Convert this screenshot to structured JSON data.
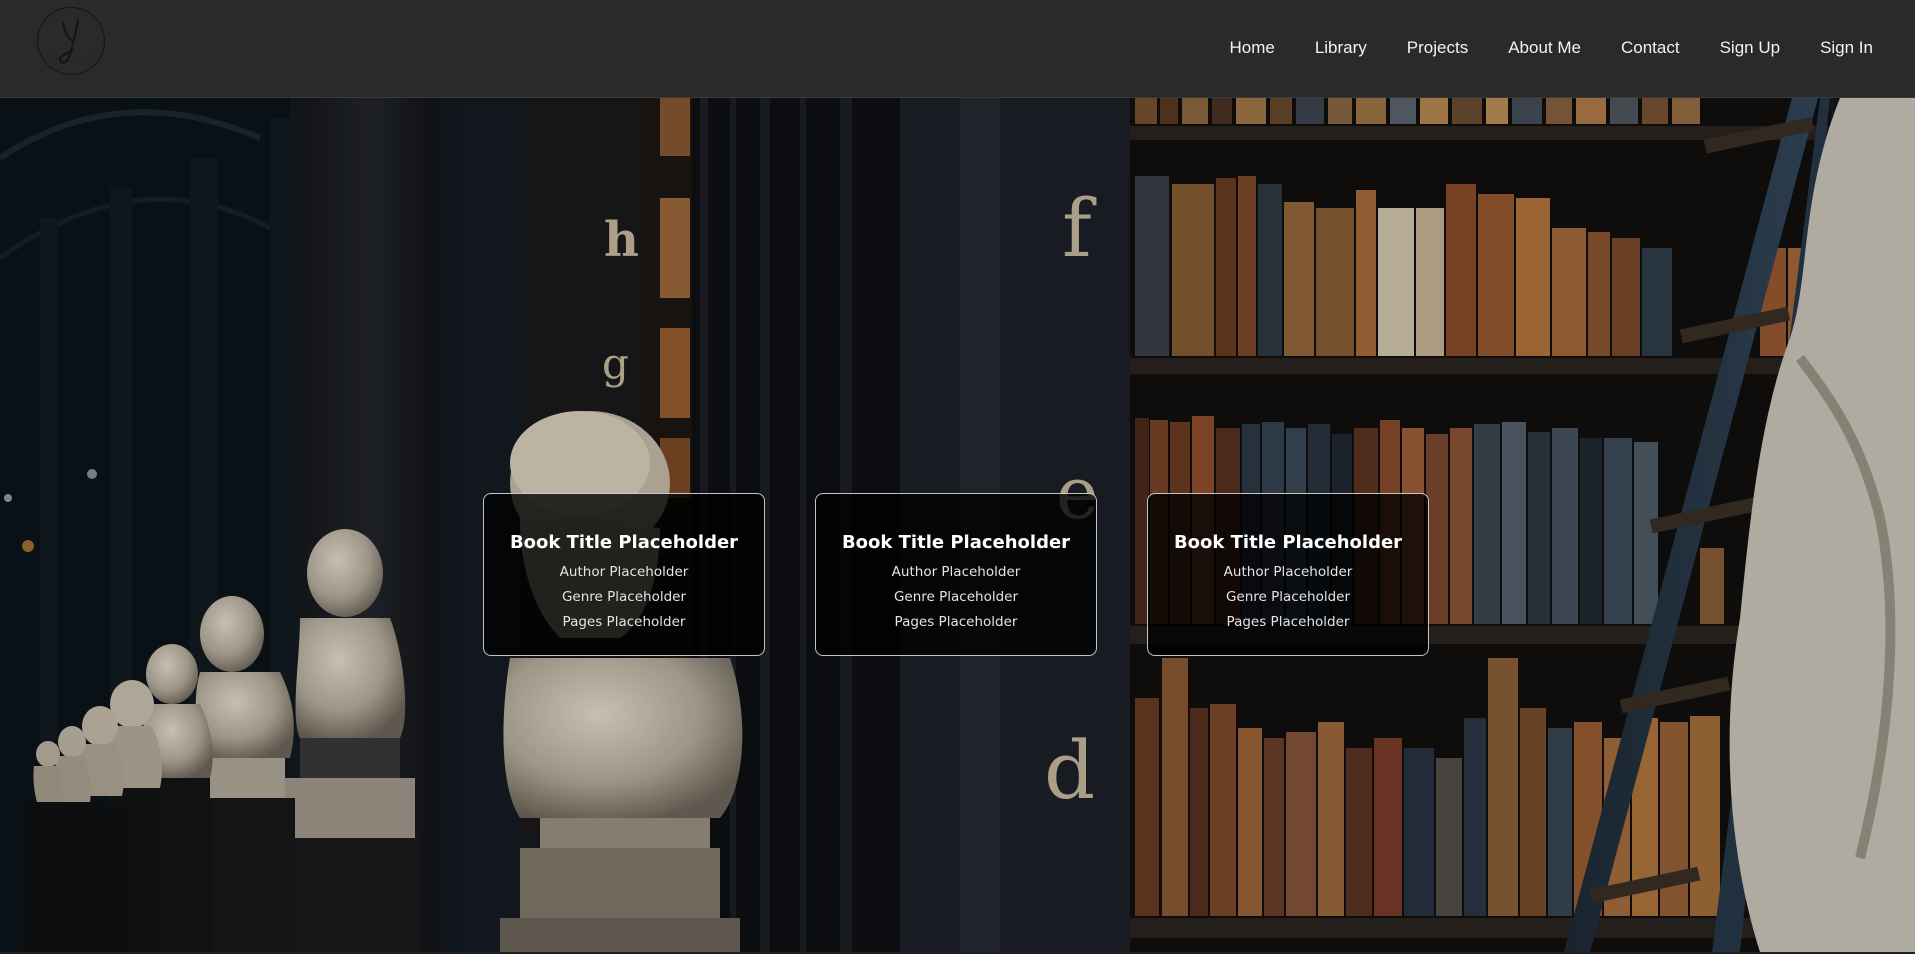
{
  "nav": {
    "logo_icon": "script-y-logo",
    "links": [
      "Home",
      "Library",
      "Projects",
      "About Me",
      "Contact",
      "Sign Up",
      "Sign In"
    ]
  },
  "hero": {
    "background": "library-hall-with-busts-and-bookshelves",
    "shelf_letters": [
      "h",
      "g",
      "f",
      "e",
      "d"
    ]
  },
  "cards": [
    {
      "title": "Book Title Placeholder",
      "author": "Author Placeholder",
      "genre": "Genre Placeholder",
      "pages": "Pages Placeholder"
    },
    {
      "title": "Book Title Placeholder",
      "author": "Author Placeholder",
      "genre": "Genre Placeholder",
      "pages": "Pages Placeholder"
    },
    {
      "title": "Book Title Placeholder",
      "author": "Author Placeholder",
      "genre": "Genre Placeholder",
      "pages": "Pages Placeholder"
    }
  ],
  "colors": {
    "navbar": "#2a2a2a",
    "nav_text": "#f2f2f2",
    "card_bg": "#000000",
    "card_border": "#e6e6e6"
  }
}
